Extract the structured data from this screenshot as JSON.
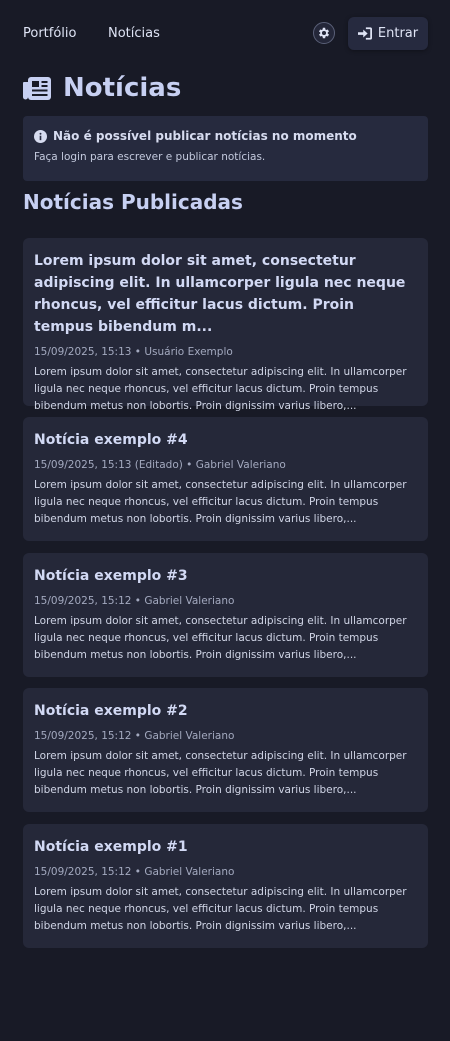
{
  "nav": {
    "links": [
      "Portfólio",
      "Notícias"
    ],
    "login_label": "Entrar"
  },
  "page": {
    "title": "Notícias"
  },
  "alert": {
    "title": "Não é possível publicar notícias no momento",
    "text": "Faça login para escrever e publicar notícias."
  },
  "section": {
    "title": "Notícias Publicadas"
  },
  "posts": [
    {
      "title": "Lorem ipsum dolor sit amet, consectetur adipiscing elit. In ullamcorper ligula nec neque rhoncus, vel efficitur lacus dictum. Proin tempus bibendum m...",
      "meta": "15/09/2025, 15:13 • Usuário Exemplo",
      "excerpt": "Lorem ipsum dolor sit amet, consectetur adipiscing elit. In ullamcorper ligula nec neque rhoncus, vel efficitur lacus dictum. Proin tempus bibendum metus non lobortis. Proin dignissim varius libero,..."
    },
    {
      "title": "Notícia exemplo #4",
      "meta": "15/09/2025, 15:13 (Editado) • Gabriel Valeriano",
      "excerpt": "Lorem ipsum dolor sit amet, consectetur adipiscing elit. In ullamcorper ligula nec neque rhoncus, vel efficitur lacus dictum. Proin tempus bibendum metus non lobortis. Proin dignissim varius libero,..."
    },
    {
      "title": "Notícia exemplo #3",
      "meta": "15/09/2025, 15:12 • Gabriel Valeriano",
      "excerpt": "Lorem ipsum dolor sit amet, consectetur adipiscing elit. In ullamcorper ligula nec neque rhoncus, vel efficitur lacus dictum. Proin tempus bibendum metus non lobortis. Proin dignissim varius libero,..."
    },
    {
      "title": "Notícia exemplo #2",
      "meta": "15/09/2025, 15:12 • Gabriel Valeriano",
      "excerpt": "Lorem ipsum dolor sit amet, consectetur adipiscing elit. In ullamcorper ligula nec neque rhoncus, vel efficitur lacus dictum. Proin tempus bibendum metus non lobortis. Proin dignissim varius libero,..."
    },
    {
      "title": "Notícia exemplo #1",
      "meta": "15/09/2025, 15:12 • Gabriel Valeriano",
      "excerpt": "Lorem ipsum dolor sit amet, consectetur adipiscing elit. In ullamcorper ligula nec neque rhoncus, vel efficitur lacus dictum. Proin tempus bibendum metus non lobortis. Proin dignissim varius libero,..."
    }
  ],
  "icons": {
    "theme": "gear-icon",
    "login": "sign-in-icon",
    "title": "newspaper-icon",
    "alert": "info-circle-icon"
  },
  "colors": {
    "background": "#181a26",
    "card": "#252839",
    "text": "#cfd6ef"
  }
}
